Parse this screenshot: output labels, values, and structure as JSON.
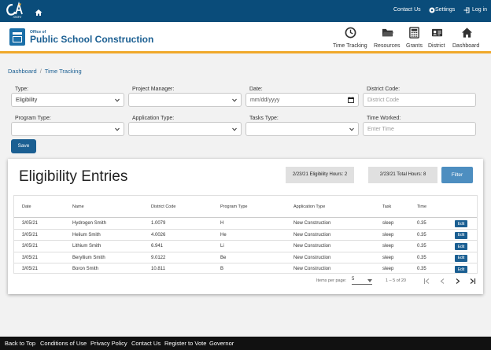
{
  "topbar": {
    "logo_text": "CA.GOV",
    "links": {
      "contact": "Contact Us",
      "settings": "Settings",
      "login": "Log in"
    }
  },
  "header": {
    "org_small": "Office of",
    "org_name": "Public School Construction",
    "nav": [
      {
        "label": "Time Tracking",
        "icon": "clock-icon"
      },
      {
        "label": "Resources",
        "icon": "folder-icon"
      },
      {
        "label": "Grants",
        "icon": "calculator-icon"
      },
      {
        "label": "District",
        "icon": "id-card-icon"
      },
      {
        "label": "Dashboard",
        "icon": "home-icon"
      }
    ]
  },
  "breadcrumb": {
    "items": [
      "Dashboard",
      "Time Tracking"
    ],
    "separator": "/"
  },
  "form": {
    "type": {
      "label": "Type:",
      "value": "Eligibility"
    },
    "project_manager": {
      "label": "Project Manager:",
      "value": ""
    },
    "date": {
      "label": "Date:",
      "placeholder": "mm/dd/yyyy"
    },
    "district_code": {
      "label": "District Code:",
      "placeholder": "District Code"
    },
    "program_type": {
      "label": "Program Type:",
      "value": ""
    },
    "application_type": {
      "label": "Application Type:",
      "value": ""
    },
    "tasks_type": {
      "label": "Tasks Type:",
      "value": ""
    },
    "time_worked": {
      "label": "Time Worked:",
      "placeholder": "Enter Time"
    },
    "save_label": "Save"
  },
  "entries": {
    "title": "Eligibility Entries",
    "stat_eligibility": "2/23/21 Eligibility Hours: 2",
    "stat_total": "2/23/21 Total Hours: 8",
    "filter_label": "Filter",
    "columns": [
      "Date",
      "Name",
      "District Code",
      "Program Type",
      "Application Type",
      "Task",
      "Time"
    ],
    "rows": [
      {
        "date": "3/05/21",
        "name": "Hydrogen Smith",
        "district_code": "1.0079",
        "program_type": "H",
        "application_type": "New Construction",
        "task": "sleep",
        "time": "0.35",
        "action": "Edit"
      },
      {
        "date": "3/05/21",
        "name": "Helium Smith",
        "district_code": "4.0026",
        "program_type": "He",
        "application_type": "New Construction",
        "task": "sleep",
        "time": "0.35",
        "action": "Edit"
      },
      {
        "date": "3/05/21",
        "name": "Lithium Smith",
        "district_code": "6.941",
        "program_type": "Li",
        "application_type": "New Construction",
        "task": "sleep",
        "time": "0.35",
        "action": "Edit"
      },
      {
        "date": "3/05/21",
        "name": "Beryllium Smith",
        "district_code": "9.0122",
        "program_type": "Be",
        "application_type": "New Construction",
        "task": "sleep",
        "time": "0.35",
        "action": "Edit"
      },
      {
        "date": "3/05/21",
        "name": "Boron Smith",
        "district_code": "10.811",
        "program_type": "B",
        "application_type": "New Construction",
        "task": "sleep",
        "time": "0.35",
        "action": "Edit"
      }
    ],
    "paginator": {
      "items_per_page_label": "Items per page:",
      "items_per_page": "5",
      "range": "1 – 5 of 20"
    }
  },
  "footer": {
    "links": [
      "Back to Top",
      "Conditions of Use",
      "Privacy Policy",
      "Contact Us",
      "Register to Vote",
      "Governor"
    ]
  },
  "colors": {
    "topbar": "#0a4c7a",
    "brand_blue": "#1b5f92",
    "accent_gold": "#f0a92b",
    "filter_button": "#4d8ec0",
    "footer": "#111111"
  }
}
